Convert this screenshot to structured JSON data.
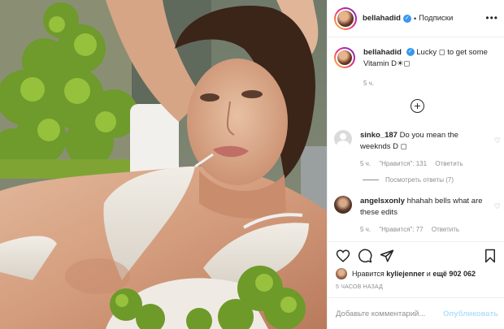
{
  "photo": {
    "description_name": "post-photo"
  },
  "header": {
    "username": "bellahadid",
    "separator": "•",
    "follow_label": "Подписки",
    "more_label": "•••"
  },
  "caption": {
    "username": "bellahadid",
    "text": "Lucky ◻ to get some Vitamin D☀◻",
    "time": "5 ч."
  },
  "add_icon_label": "+",
  "comments": [
    {
      "username": "sinko_187",
      "text": "Do you mean the weeknds D ◻",
      "time": "5 ч.",
      "likes": "\"Нравится\": 131",
      "reply": "Ответить"
    },
    {
      "username": "angelsxonly",
      "text": "hhahah bells what are these edits",
      "time": "5 ч.",
      "likes": "\"Нравится\": 77",
      "reply": "Ответить"
    }
  ],
  "view_replies": "Посмотреть ответы (7)",
  "likes": {
    "prefix": "Нравится",
    "user": "kyliejenner",
    "suffix": "и",
    "count": "ещё 902 062"
  },
  "time_ago": "5 ЧАСОВ НАЗАД",
  "add_comment": {
    "placeholder": "Добавьте комментарий...",
    "post_label": "Опубликовать"
  },
  "colors": {
    "link_blue": "#3897f0",
    "post_disabled": "#b2dffc",
    "muted": "#8e8e8e"
  }
}
